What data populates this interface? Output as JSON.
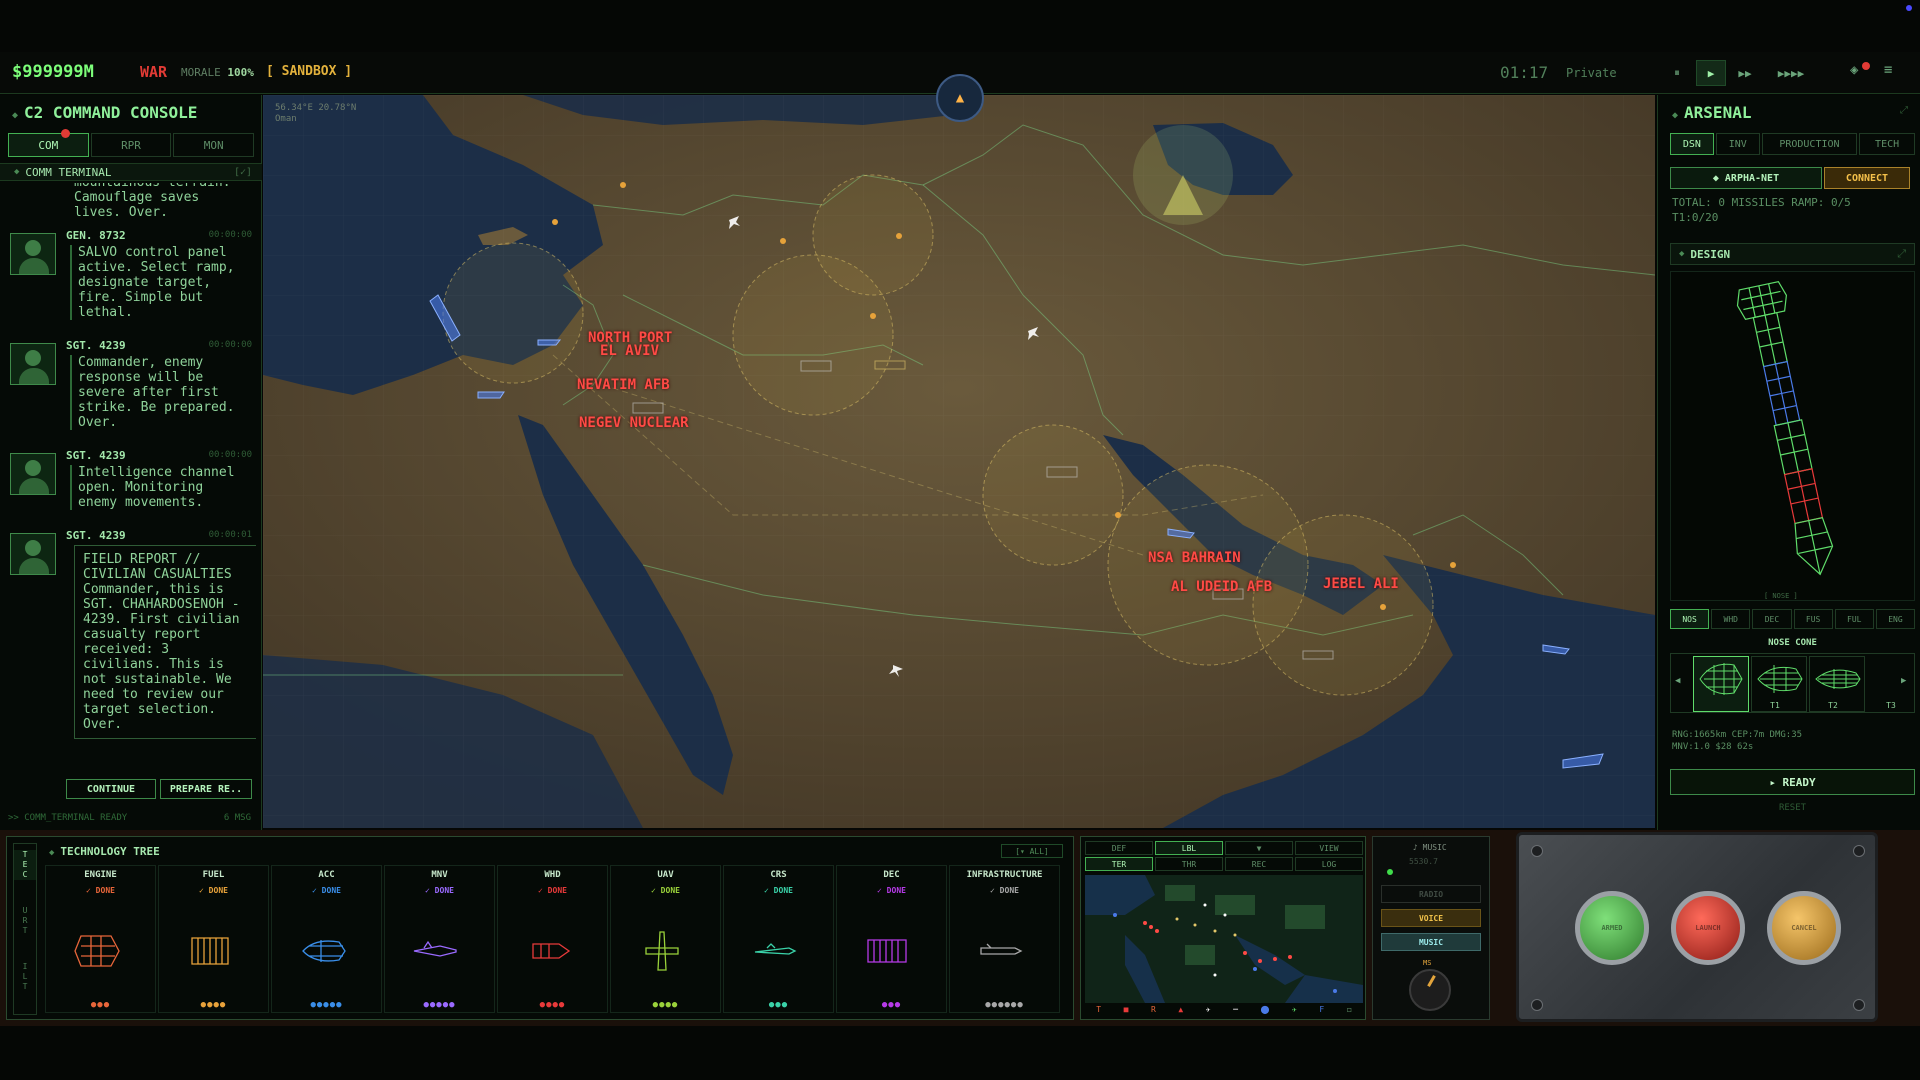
{
  "topbar": {
    "money": "$999999M",
    "war": "WAR",
    "morale_label": "MORALE",
    "morale_value": "100%",
    "mode": "[ SANDBOX ]",
    "clock": "01:17",
    "rank": "Private",
    "speed": {
      "pause": "⏸",
      "play": "▶",
      "fast": "▶▶",
      "fastest": "▶▶▶▶"
    }
  },
  "left": {
    "title": "C2 COMMAND CONSOLE",
    "tabs": [
      "COM",
      "RPR",
      "MON"
    ],
    "subhead": "COMM TERMINAL",
    "subhead_icon": "[✓]",
    "tail_text": "mountainous terrain.\nCamouflage saves\nlives. Over.",
    "messages": [
      {
        "sender": "GEN. 8732",
        "time": "00:00:00",
        "body": "SALVO control panel\nactive. Select ramp,\ndesignate target,\nfire. Simple but\nlethal."
      },
      {
        "sender": "SGT. 4239",
        "time": "00:00:00",
        "body": "Commander, enemy\nresponse will be\nsevere after first\nstrike. Be prepared.\nOver."
      },
      {
        "sender": "SGT. 4239",
        "time": "00:00:00",
        "body": "Intelligence channel\nopen. Monitoring\nenemy movements."
      },
      {
        "sender": "SGT. 4239",
        "time": "00:00:01",
        "body": "FIELD REPORT //\nCIVILIAN CASUALTIES\nCommander, this is\nSGT. CHAHARDOSENOH -\n4239. First civilian\ncasualty report\nreceived: 3\ncivilians.  This is\nnot sustainable. We\nneed to review our\ntarget selection.\nOver."
      }
    ],
    "continue_btn": "CONTINUE",
    "prepare_btn": "PREPARE RE..",
    "status": ">> COMM_TERMINAL READY",
    "msg_count": "6 MSG"
  },
  "map": {
    "coord_line1": "56.34°E 20.78°N",
    "coord_line2": "Oman",
    "targets": [
      "NORTH PORT",
      "EL AVIV",
      "NEVATIM AFB",
      "NEGEV NUCLEAR",
      "NSA BAHRAIN",
      "AL UDEID AFB",
      "JEBEL ALI"
    ]
  },
  "right": {
    "title": "ARSENAL",
    "tabs": [
      "DSN",
      "INV",
      "PRODUCTION",
      "TECH"
    ],
    "net_btn": "◆ ARPHA-NET",
    "connect_btn": "CONNECT",
    "stat_line1": "TOTAL: 0 MISSILES RAMP: 0/5",
    "stat_line2": "T1:0/20",
    "design_hdr": "DESIGN",
    "nose_tag": "[ NOSE ]",
    "part_tabs": [
      "NOS",
      "WHD",
      "DEC",
      "FUS",
      "FUL",
      "ENG"
    ],
    "part_label": "NOSE CONE",
    "cards": [
      "T1",
      "T2",
      "T3"
    ],
    "specs_line1": "RNG:1665km CEP:7m DMG:35",
    "specs_line2": "MNV:1.0 $28 62s",
    "ready_btn": "▸ READY",
    "reset_btn": "RESET"
  },
  "tech": {
    "side_tabs": [
      "TEC",
      "URT",
      "ILT"
    ],
    "title": "TECHNOLOGY TREE",
    "all_btn": "[▾ ALL]",
    "columns": [
      {
        "name": "ENGINE",
        "status": "✓ DONE",
        "dots": "●●●",
        "color": "#e8663a"
      },
      {
        "name": "FUEL",
        "status": "✓ DONE",
        "dots": "●●●●",
        "color": "#e8a23a"
      },
      {
        "name": "ACC",
        "status": "✓ DONE",
        "dots": "●●●●●",
        "color": "#3a8ee8"
      },
      {
        "name": "MNV",
        "status": "✓ DONE",
        "dots": "●●●●●",
        "color": "#9a6aff"
      },
      {
        "name": "WHD",
        "status": "✓ DONE",
        "dots": "●●●●",
        "color": "#e83a3a"
      },
      {
        "name": "UAV",
        "status": "✓ DONE",
        "dots": "●●●●",
        "color": "#9ad23a"
      },
      {
        "name": "CRS",
        "status": "✓ DONE",
        "dots": "●●●",
        "color": "#3ad2a8"
      },
      {
        "name": "DEC",
        "status": "✓ DONE",
        "dots": "●●●",
        "color": "#b63ae8"
      },
      {
        "name": "INFRASTRUCTURE",
        "status": "✓ DONE",
        "dots": "●●●●●●",
        "color": "#a8a8a8"
      }
    ]
  },
  "minimap": {
    "tabs_row1": [
      "DEF",
      "LBL",
      "▼",
      "VIEW"
    ],
    "tabs_row2": [
      "TER",
      "THR",
      "REC",
      "LOG"
    ],
    "legend": [
      "T",
      "■",
      "R",
      "▲",
      "✈",
      "━",
      "⬤",
      "✈",
      "F",
      "◻"
    ]
  },
  "audio": {
    "music_label": "♪ MUSIC",
    "track": "5530.7",
    "radio": "RADIO",
    "voice": "VOICE",
    "music": "MUSIC",
    "knob_label": "MS"
  },
  "console_buttons": [
    "ARMED",
    "LAUNCH",
    "CANCEL"
  ]
}
